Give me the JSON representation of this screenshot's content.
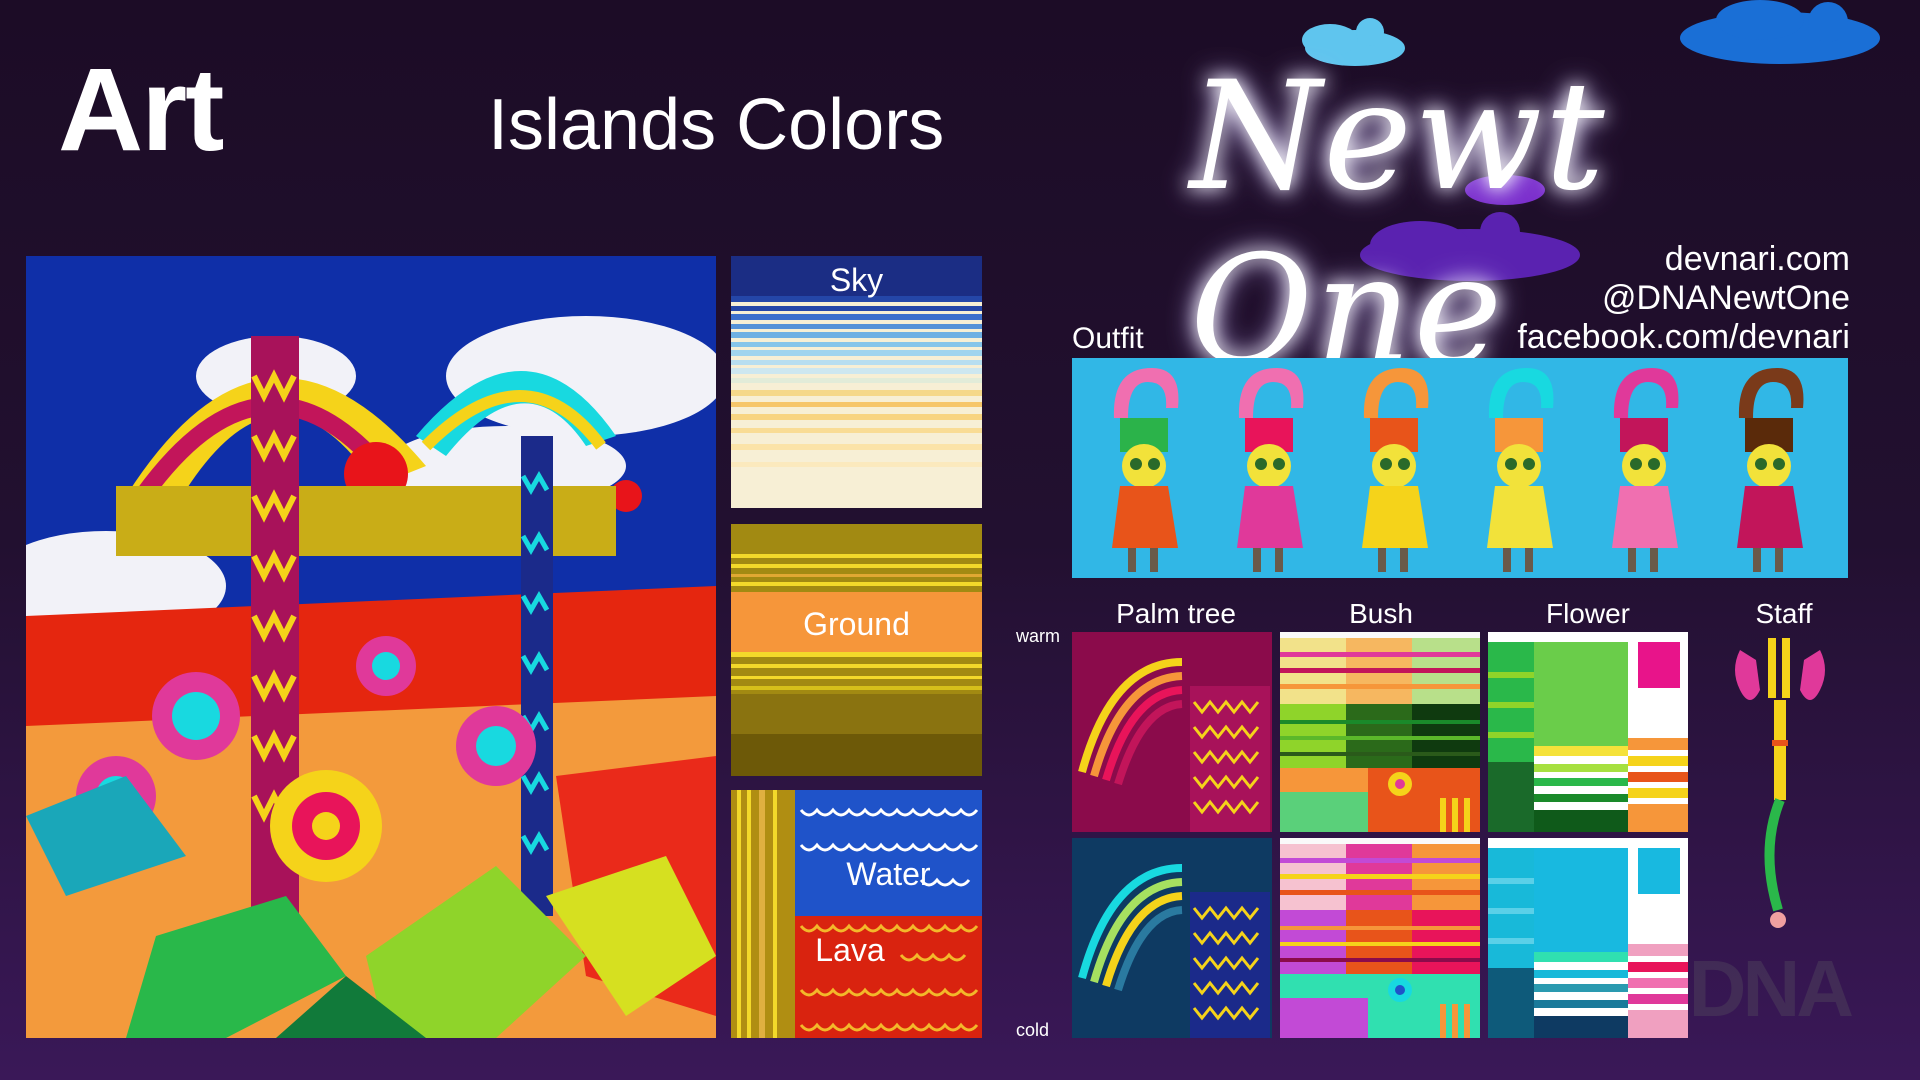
{
  "header": {
    "title": "Art",
    "subtitle": "Islands Colors"
  },
  "logo": {
    "text": "Newt One"
  },
  "links": {
    "website": "devnari.com",
    "twitter": "@DNANewtOne",
    "facebook": "facebook.com/devnari"
  },
  "swatches": {
    "sky": "Sky",
    "ground": "Ground",
    "water": "Water",
    "lava": "Lava"
  },
  "outfit": {
    "label": "Outfit"
  },
  "palette": {
    "palm_tree": "Palm tree",
    "bush": "Bush",
    "flower": "Flower",
    "staff": "Staff",
    "warm": "warm",
    "cold": "cold"
  },
  "watermark": "DNA",
  "colors": {
    "sky_blue": "#31b7e6",
    "ground_olive": "#a28a12",
    "ground_orange": "#f6963a",
    "water_blue": "#1f53c9",
    "lava_red": "#d9230f",
    "warm_bg": "#8b0b4b",
    "cold_bg": "#0e3a62"
  }
}
